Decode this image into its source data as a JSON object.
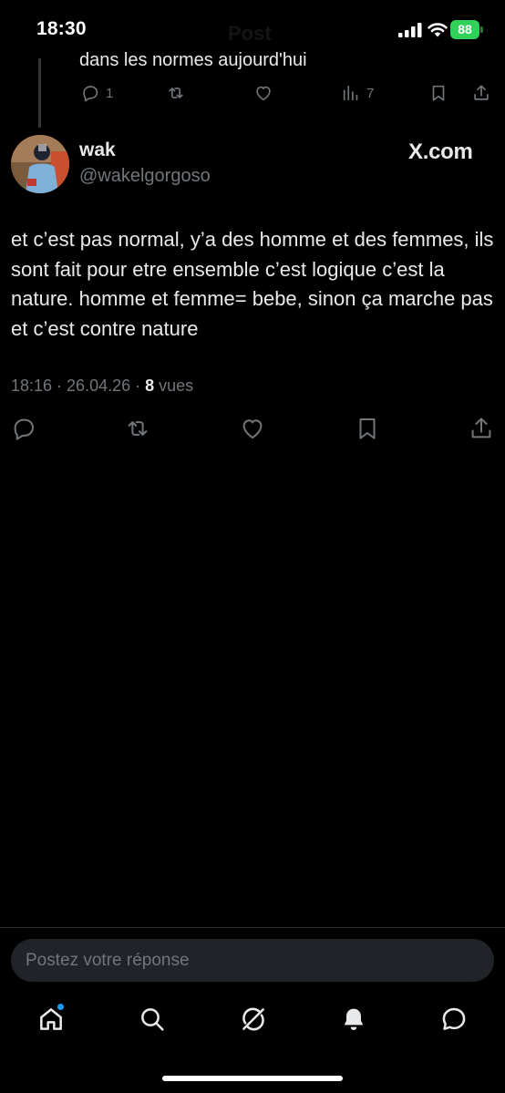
{
  "status_bar": {
    "time": "18:30",
    "title": "Post",
    "battery_level": "88",
    "icons": [
      "signal-icon",
      "wifi-icon",
      "battery-icon"
    ]
  },
  "parent_post": {
    "text_fragment": "dans les normes aujourd'hui",
    "actions": {
      "reply_count": "1",
      "views_count": "7"
    }
  },
  "post": {
    "author_name": "wak",
    "author_handle": "@wakelgorgoso",
    "source_logo": "X.com",
    "text": "et c’est pas normal, y’a des homme et des femmes, ils sont fait pour etre ensemble c’est logique c’est la nature. homme et femme= bebe, sinon ça marche pas et c’est contre nature",
    "time": "18:16",
    "date": "26.04.26",
    "separator": " · ",
    "views_count": "8",
    "views_label": " vues"
  },
  "reply": {
    "placeholder": "Postez votre réponse"
  },
  "nav": {
    "items": [
      "home-icon",
      "search-icon",
      "grok-icon",
      "notifications-icon",
      "messages-icon"
    ],
    "active": "home-icon"
  },
  "colors": {
    "background": "#000000",
    "text": "#e7e9ea",
    "secondary_text": "#71767b",
    "accent": "#1d9bf0",
    "battery": "#30d158",
    "input_bg": "#202327"
  }
}
